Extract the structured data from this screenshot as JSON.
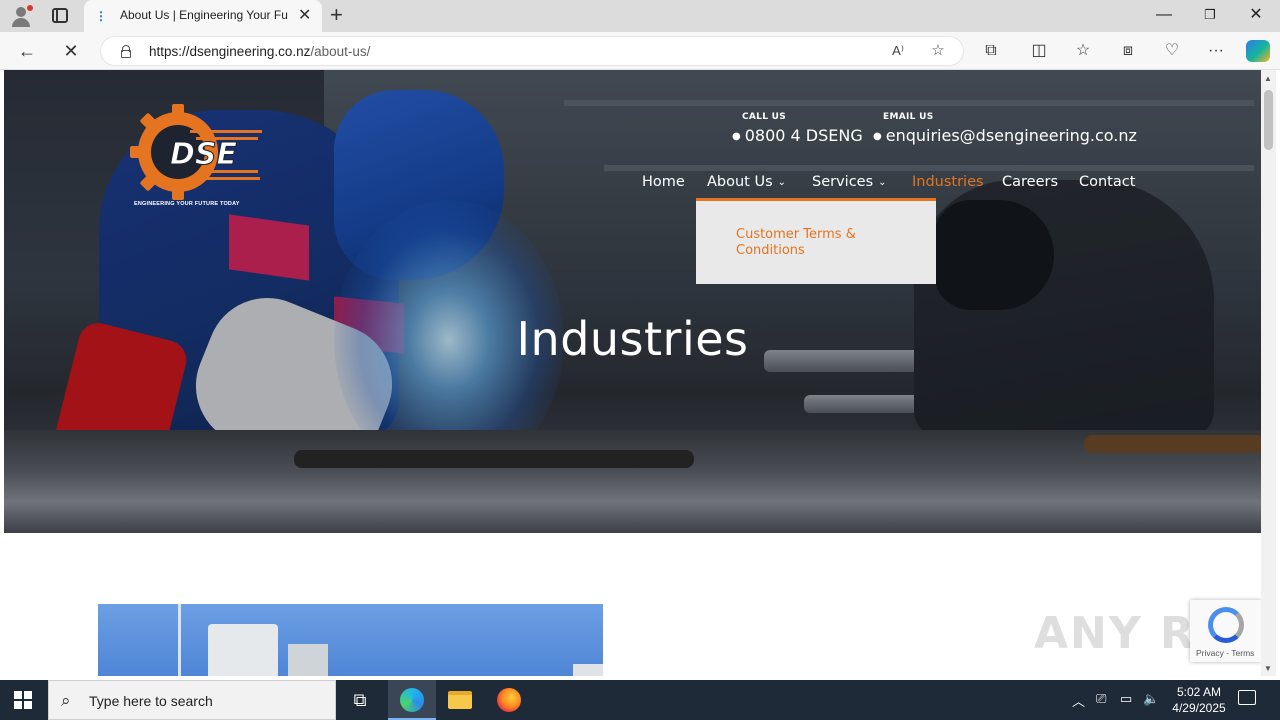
{
  "browser": {
    "tab_title": "About Us | Engineering Your Future",
    "new_tab_glyph": "+",
    "url_host": "https://dsengineering.co.nz",
    "url_path": "/about-us/",
    "icons": [
      "profile-icon",
      "tab-actions-icon",
      "back-icon",
      "stop-icon",
      "lock-icon",
      "read-aloud-icon",
      "favorite-star-icon",
      "extensions-icon",
      "split-screen-icon",
      "favorites-icon",
      "collections-icon",
      "browser-essentials-icon",
      "more-icon",
      "copilot-icon"
    ]
  },
  "site": {
    "logo_text": "DSE",
    "logo_tagline": "ENGINEERING YOUR FUTURE TODAY",
    "brand_orange": "#e4741f",
    "contact": {
      "call_label": "CALL US",
      "call_value": "0800 4 DSENG",
      "email_label": "EMAIL US",
      "email_value": "enquiries@dsengineering.co.nz"
    },
    "nav": {
      "home": "Home",
      "about": "About Us",
      "services": "Services",
      "industries": "Industries",
      "careers": "Careers",
      "contact": "Contact",
      "active": "Industries"
    },
    "dropdown": {
      "item": "Customer Terms & Conditions"
    },
    "hero_title": "Industries",
    "watermark": "ANY RUN",
    "recaptcha_links": "Privacy - Terms"
  },
  "taskbar": {
    "search_placeholder": "Type here to search",
    "time": "5:02 AM",
    "date": "4/29/2025"
  }
}
